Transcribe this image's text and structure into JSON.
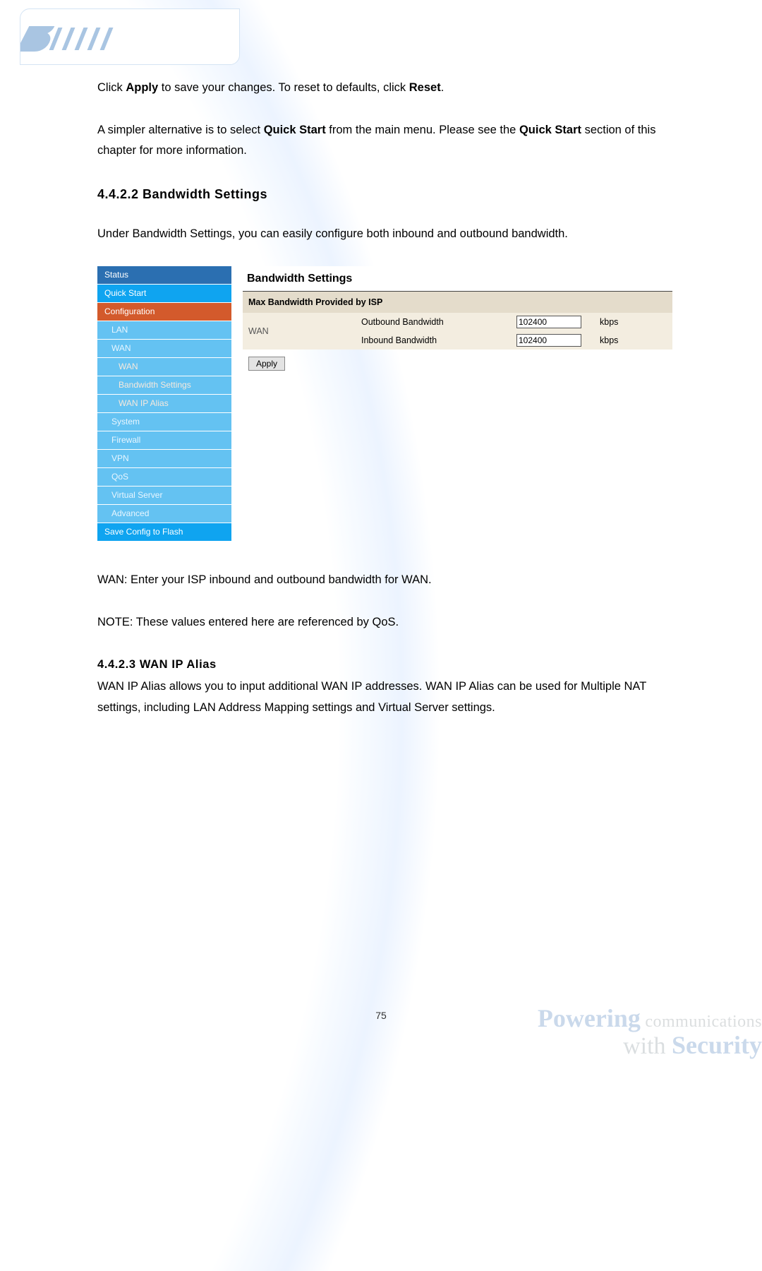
{
  "body": {
    "p1a": "Click ",
    "p1b": "Apply",
    "p1c": " to save your changes. To reset to defaults, click ",
    "p1d": "Reset",
    "p1e": ".",
    "p2a": "A simpler alternative is to select ",
    "p2b": "Quick Start",
    "p2c": " from the main menu. Please see the ",
    "p2d": "Quick Start",
    "p2e": " section of this chapter for more information.",
    "h1": "4.4.2.2   Bandwidth Settings",
    "p3": "Under Bandwidth Settings, you can easily configure both inbound and outbound bandwidth.",
    "p4": "WAN: Enter your ISP inbound and outbound bandwidth for WAN.",
    "p5": "NOTE: These values entered here are referenced by QoS.",
    "h2": "4.4.2.3   WAN IP Alias",
    "p6": "WAN IP Alias allows you to input additional WAN IP addresses. WAN IP Alias can be used for Multiple NAT settings, including LAN Address Mapping settings and Virtual Server settings."
  },
  "sidebar": {
    "status": "Status",
    "quick_start": "Quick Start",
    "configuration": "Configuration",
    "lan": "LAN",
    "wan_top": "WAN",
    "wan_sub": "WAN",
    "bandwidth_settings": "Bandwidth Settings",
    "wan_ip_alias": "WAN IP Alias",
    "system": "System",
    "firewall": "Firewall",
    "vpn": "VPN",
    "qos": "QoS",
    "virtual_server": "Virtual Server",
    "advanced": "Advanced",
    "save_config": "Save Config to Flash"
  },
  "panel": {
    "title": "Bandwidth Settings",
    "subtitle": "Max Bandwidth Provided by ISP",
    "wan": "WAN",
    "outbound_label": "Outbound Bandwidth",
    "inbound_label": "Inbound Bandwidth",
    "outbound_value": "102400",
    "inbound_value": "102400",
    "unit": "kbps",
    "apply_label": "Apply"
  },
  "footer": {
    "page": "75",
    "wm_strong": "Powering",
    "wm_light": " communications",
    "wm_with": "with ",
    "wm_sec": "Security"
  }
}
